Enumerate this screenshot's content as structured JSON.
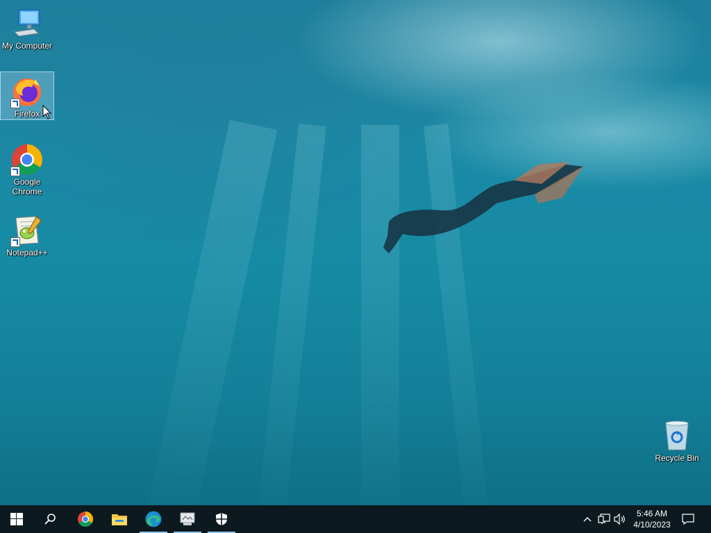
{
  "desktop": {
    "icons": [
      {
        "label": "My Computer",
        "icon": "computer-icon"
      },
      {
        "label": "Firefox",
        "icon": "firefox-icon",
        "selected": true
      },
      {
        "label": "Google Chrome",
        "icon": "chrome-icon"
      },
      {
        "label": "Notepad++",
        "icon": "notepad-plus-plus-icon"
      },
      {
        "label": "Recycle Bin",
        "icon": "recycle-bin-icon"
      }
    ]
  },
  "taskbar": {
    "pinned": [
      {
        "name": "start",
        "icon": "windows-logo-icon"
      },
      {
        "name": "search",
        "icon": "search-icon"
      },
      {
        "name": "chrome",
        "icon": "chrome-icon"
      },
      {
        "name": "file-explorer",
        "icon": "folder-icon"
      },
      {
        "name": "edge",
        "icon": "edge-icon",
        "running": true
      },
      {
        "name": "app",
        "icon": "app-window-icon",
        "running": true
      },
      {
        "name": "security",
        "icon": "shield-icon",
        "running": true
      }
    ],
    "tray": {
      "icons": [
        "chevron-up-icon",
        "network-icon",
        "volume-icon"
      ],
      "time": "5:46 AM",
      "date": "4/10/2023",
      "notification_icon": "notification-icon"
    }
  },
  "colors": {
    "taskbar_bg": "#0c1a20",
    "running_indicator": "#8ec8f0",
    "water_top": "#1e7f9c",
    "water_bottom": "#0f6f86"
  }
}
